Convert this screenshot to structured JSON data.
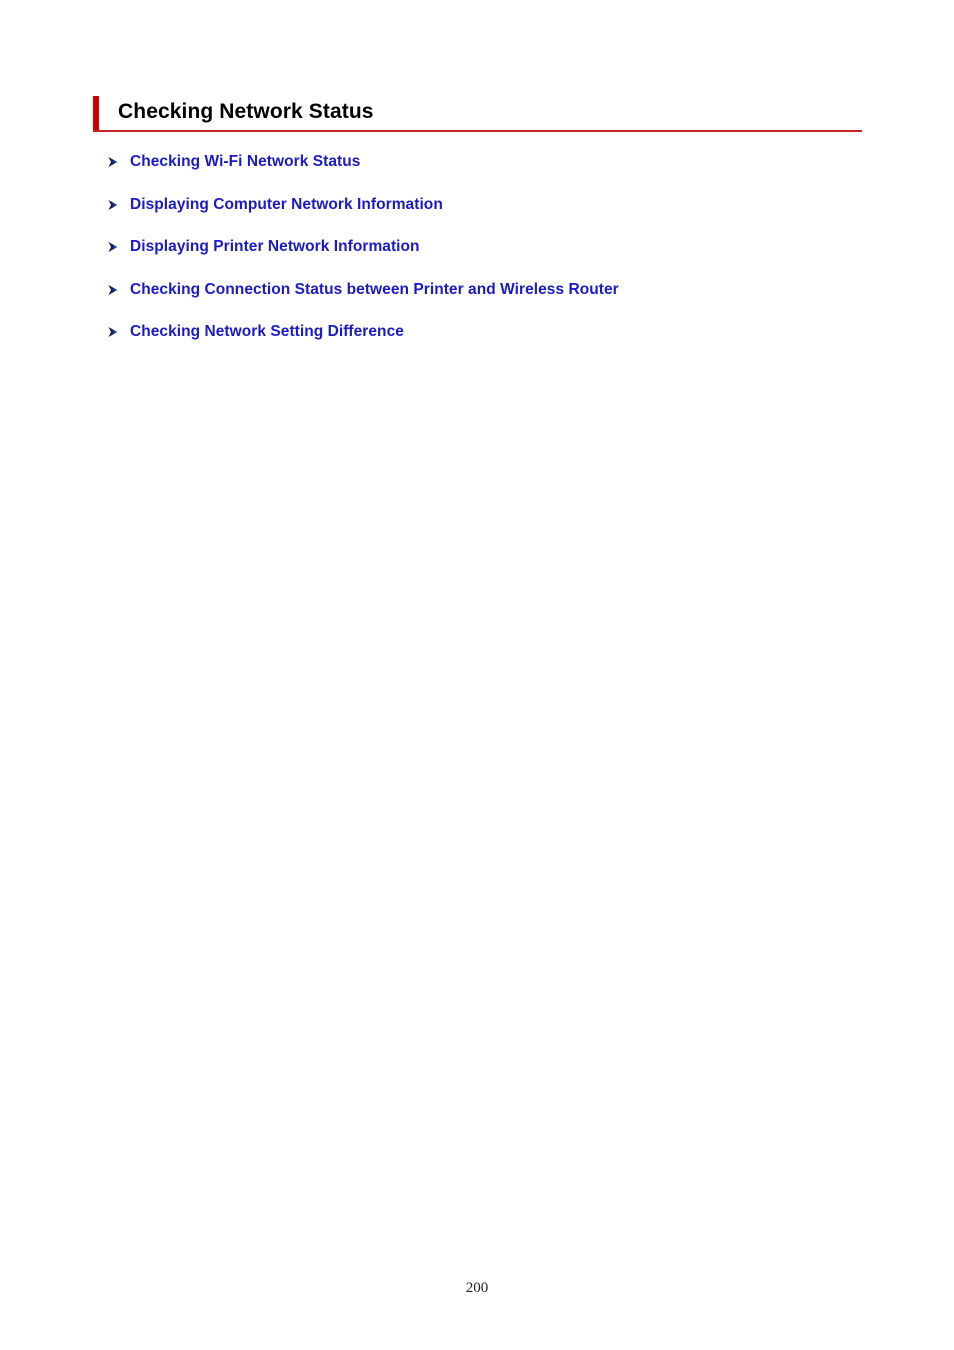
{
  "document": {
    "page_title": "Checking Network Status",
    "page_number": "200"
  },
  "header": {
    "title": "Checking Network Status",
    "accent_color": "#cc0000",
    "rule_color": "#cc2222"
  },
  "links": {
    "bullet_icon": "arrow-right-icon",
    "link_color": "#1a1acc",
    "items": [
      {
        "label": "Checking Wi-Fi Network Status"
      },
      {
        "label": "Displaying Computer Network Information"
      },
      {
        "label": "Displaying Printer Network Information"
      },
      {
        "label": "Checking Connection Status between Printer and Wireless Router"
      },
      {
        "label": "Checking Network Setting Difference"
      }
    ]
  }
}
